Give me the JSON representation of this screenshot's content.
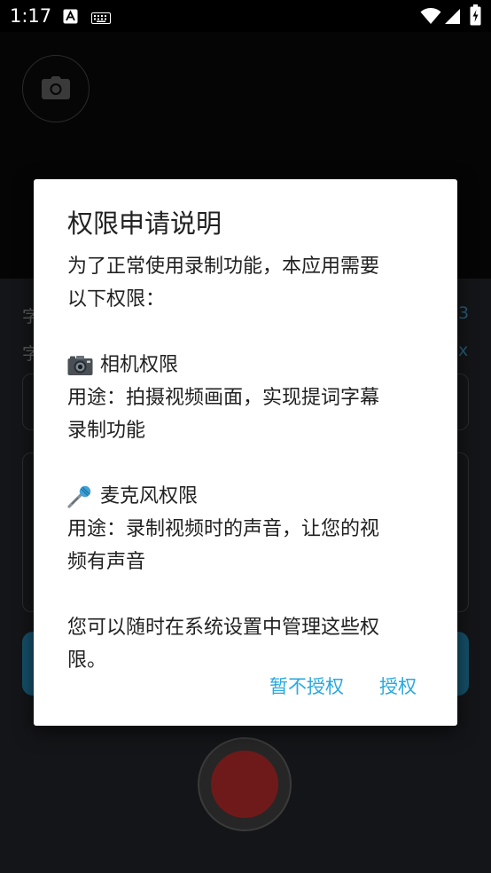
{
  "status_bar": {
    "time": "1:17",
    "icons": [
      "text-recognition-icon",
      "keyboard-icon",
      "wifi-icon",
      "cellular-signal-icon",
      "battery-charging-icon"
    ]
  },
  "camera_preview": {
    "switch_icon": "camera-icon"
  },
  "control_panel": {
    "row1_label": "字",
    "row1_value": "3",
    "row2_label": "字",
    "row2_value": "x"
  },
  "dialog": {
    "title": "权限申请说明",
    "intro_line1": "为了正常使用录制功能，本应用需要",
    "intro_line2": "以下权限：",
    "camera_icon": "camera-emoji-icon",
    "camera_title": "相机权限",
    "camera_desc_line1": "用途：拍摄视频画面，实现提词字幕",
    "camera_desc_line2": "录制功能",
    "mic_icon": "microphone-emoji-icon",
    "mic_title": "麦克风权限",
    "mic_desc_line1": "用途：录制视频时的声音，让您的视",
    "mic_desc_line2": "频有声音",
    "footer_line1": "您可以随时在系统设置中管理这些权",
    "footer_line2": "限。",
    "deny_label": "暂不授权",
    "grant_label": "授权"
  },
  "colors": {
    "accent": "#29a9e0",
    "record": "#6f1a1a",
    "dialog_bg": "#ffffff",
    "text": "#212121"
  }
}
